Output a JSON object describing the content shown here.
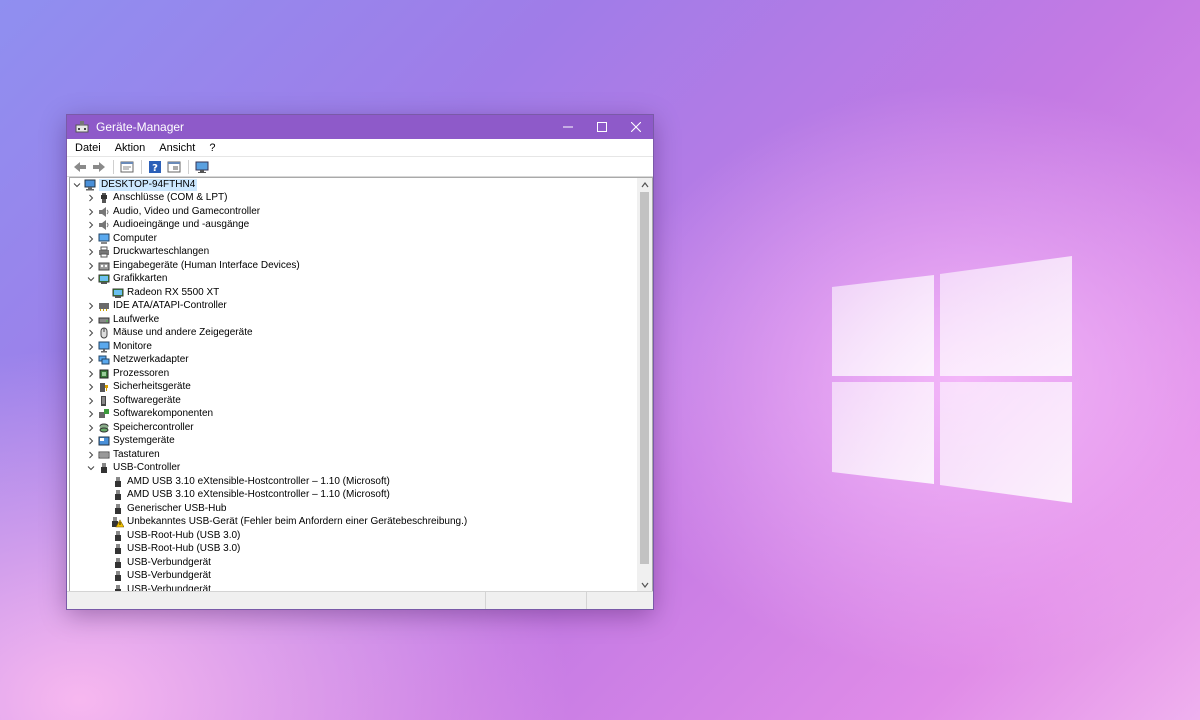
{
  "window": {
    "title": "Geräte-Manager",
    "titlebar_color": "#8e5ac9"
  },
  "menu": [
    "Datei",
    "Aktion",
    "Ansicht",
    "?"
  ],
  "toolbar": {
    "icons": [
      "back-arrow-icon",
      "forward-arrow-icon",
      "properties-icon",
      "help-icon",
      "show-hidden-icon",
      "monitor-icon"
    ]
  },
  "tree": {
    "root": "DESKTOP-94FTHN4",
    "categories": [
      {
        "label": "Anschlüsse (COM & LPT)",
        "icon": "port-icon"
      },
      {
        "label": "Audio, Video und Gamecontroller",
        "icon": "speaker-icon"
      },
      {
        "label": "Audioeingänge und -ausgänge",
        "icon": "speaker-icon"
      },
      {
        "label": "Computer",
        "icon": "computer-icon"
      },
      {
        "label": "Druckwarteschlangen",
        "icon": "printer-icon"
      },
      {
        "label": "Eingabegeräte (Human Interface Devices)",
        "icon": "hid-icon"
      },
      {
        "label": "Grafikkarten",
        "icon": "display-adapter-icon",
        "expanded": true,
        "children": [
          "Radeon RX 5500 XT"
        ]
      },
      {
        "label": "IDE ATA/ATAPI-Controller",
        "icon": "ide-icon"
      },
      {
        "label": "Laufwerke",
        "icon": "drive-icon"
      },
      {
        "label": "Mäuse und andere Zeigegeräte",
        "icon": "mouse-icon"
      },
      {
        "label": "Monitore",
        "icon": "monitor-icon"
      },
      {
        "label": "Netzwerkadapter",
        "icon": "network-icon"
      },
      {
        "label": "Prozessoren",
        "icon": "processor-icon"
      },
      {
        "label": "Sicherheitsgeräte",
        "icon": "security-icon"
      },
      {
        "label": "Softwaregeräte",
        "icon": "software-device-icon"
      },
      {
        "label": "Softwarekomponenten",
        "icon": "software-component-icon"
      },
      {
        "label": "Speichercontroller",
        "icon": "storage-icon"
      },
      {
        "label": "Systemgeräte",
        "icon": "system-icon"
      },
      {
        "label": "Tastaturen",
        "icon": "keyboard-icon"
      },
      {
        "label": "USB-Controller",
        "icon": "usb-icon",
        "expanded": true,
        "children": [
          "AMD USB 3.10 eXtensible-Hostcontroller – 1.10 (Microsoft)",
          "AMD USB 3.10 eXtensible-Hostcontroller – 1.10 (Microsoft)",
          "Generischer USB-Hub",
          "Unbekanntes USB-Gerät (Fehler beim Anfordern einer Gerätebeschreibung.)",
          "USB-Root-Hub (USB 3.0)",
          "USB-Root-Hub (USB 3.0)",
          "USB-Verbundgerät",
          "USB-Verbundgerät",
          "USB-Verbundgerät"
        ],
        "warning_child_index": 3
      }
    ]
  }
}
